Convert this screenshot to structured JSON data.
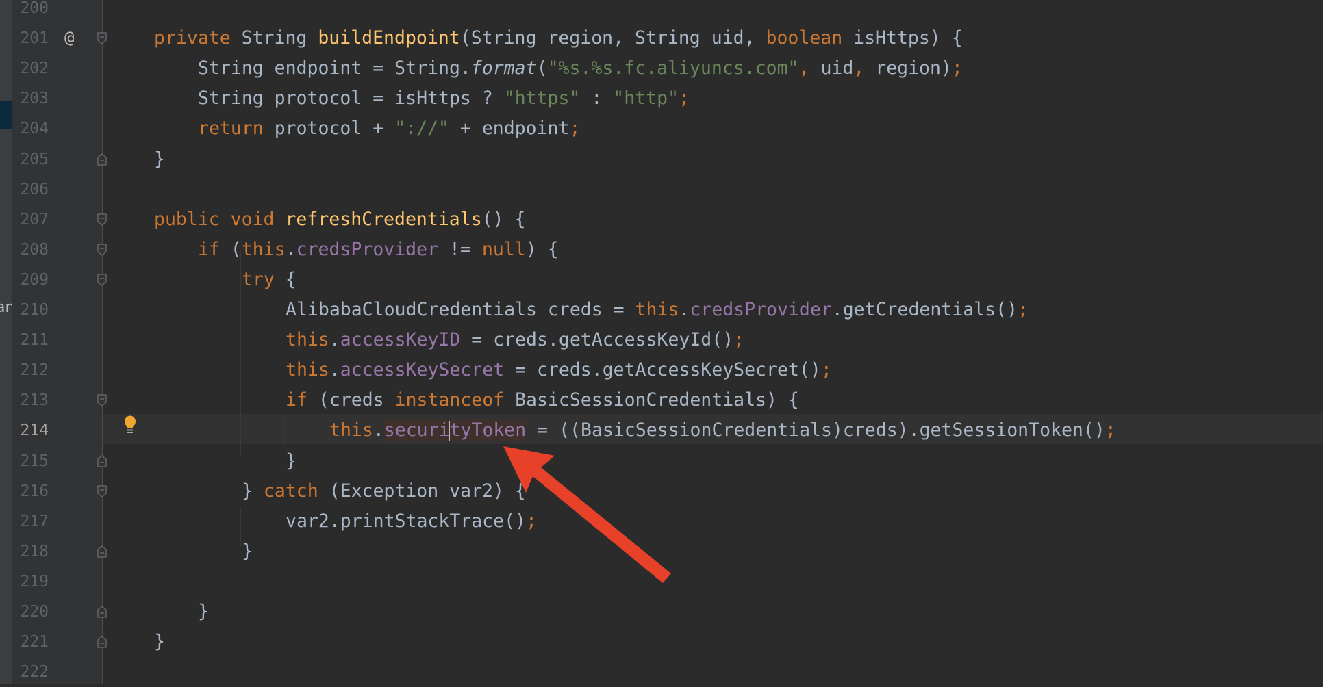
{
  "left_strip_fragment": "am",
  "current_line": 214,
  "colors": {
    "keyword": "#cc7832",
    "default": "#a9b7c6",
    "method_decl": "#ffc66d",
    "string": "#6a8759",
    "field": "#9876aa",
    "annotation_arrow": "#e8412a",
    "bulb": "#f0a732"
  },
  "gutter_icons": {
    "201": "override-at-icon",
    "214": "lightbulb-icon"
  },
  "code": {
    "lines": [
      {
        "n": "200",
        "indent": 0,
        "tokens": []
      },
      {
        "n": "201",
        "indent": 0,
        "fold": "open",
        "tokens": [
          [
            "kw",
            "private"
          ],
          [
            "pl",
            " String "
          ],
          [
            "fn",
            "buildEndpoint"
          ],
          [
            "pl",
            "(String region, String uid, "
          ],
          [
            "kw",
            "boolean"
          ],
          [
            "pl",
            " isHttps) {"
          ]
        ]
      },
      {
        "n": "202",
        "indent": 1,
        "tokens": [
          [
            "pl",
            "String endpoint = String."
          ],
          [
            "it",
            "format"
          ],
          [
            "pl",
            "("
          ],
          [
            "str",
            "\"%s.%s.fc.aliyuncs.com\""
          ],
          [
            "kw",
            ", "
          ],
          [
            "pl",
            "uid"
          ],
          [
            "kw",
            ", "
          ],
          [
            "pl",
            "region)"
          ],
          [
            "kw",
            ";"
          ]
        ]
      },
      {
        "n": "203",
        "indent": 1,
        "tokens": [
          [
            "pl",
            "String protocol = isHttps ? "
          ],
          [
            "str",
            "\"https\""
          ],
          [
            "pl",
            " : "
          ],
          [
            "str",
            "\"http\""
          ],
          [
            "kw",
            ";"
          ]
        ]
      },
      {
        "n": "204",
        "indent": 1,
        "tokens": [
          [
            "kw",
            "return"
          ],
          [
            "pl",
            " protocol + "
          ],
          [
            "str",
            "\"://\""
          ],
          [
            "pl",
            " + endpoint"
          ],
          [
            "kw",
            ";"
          ]
        ]
      },
      {
        "n": "205",
        "indent": 0,
        "fold": "close",
        "tokens": [
          [
            "pl",
            "}"
          ]
        ]
      },
      {
        "n": "206",
        "indent": 0,
        "tokens": []
      },
      {
        "n": "207",
        "indent": 0,
        "fold": "open",
        "tokens": [
          [
            "kw",
            "public void"
          ],
          [
            "pl",
            " "
          ],
          [
            "fn",
            "refreshCredentials"
          ],
          [
            "pl",
            "() {"
          ]
        ]
      },
      {
        "n": "208",
        "indent": 1,
        "fold": "open",
        "tokens": [
          [
            "kw",
            "if"
          ],
          [
            "pl",
            " ("
          ],
          [
            "kw",
            "this"
          ],
          [
            "pl",
            "."
          ],
          [
            "fld",
            "credsProvider"
          ],
          [
            "pl",
            " != "
          ],
          [
            "kw",
            "null"
          ],
          [
            "pl",
            ") {"
          ]
        ]
      },
      {
        "n": "209",
        "indent": 2,
        "fold": "open",
        "tokens": [
          [
            "kw",
            "try"
          ],
          [
            "pl",
            " {"
          ]
        ]
      },
      {
        "n": "210",
        "indent": 3,
        "tokens": [
          [
            "pl",
            "AlibabaCloudCredentials creds = "
          ],
          [
            "kw",
            "this"
          ],
          [
            "pl",
            "."
          ],
          [
            "fld",
            "credsProvider"
          ],
          [
            "pl",
            ".getCredentials()"
          ],
          [
            "kw",
            ";"
          ]
        ]
      },
      {
        "n": "211",
        "indent": 3,
        "tokens": [
          [
            "kw",
            "this"
          ],
          [
            "pl",
            "."
          ],
          [
            "fld",
            "accessKeyID"
          ],
          [
            "pl",
            " = creds.getAccessKeyId()"
          ],
          [
            "kw",
            ";"
          ]
        ]
      },
      {
        "n": "212",
        "indent": 3,
        "tokens": [
          [
            "kw",
            "this"
          ],
          [
            "pl",
            "."
          ],
          [
            "fld",
            "accessKeySecret"
          ],
          [
            "pl",
            " = creds.getAccessKeySecret()"
          ],
          [
            "kw",
            ";"
          ]
        ]
      },
      {
        "n": "213",
        "indent": 3,
        "fold": "open",
        "tokens": [
          [
            "kw",
            "if"
          ],
          [
            "pl",
            " (creds "
          ],
          [
            "kw",
            "instanceof"
          ],
          [
            "pl",
            " BasicSessionCredentials) {"
          ]
        ]
      },
      {
        "n": "214",
        "indent": 4,
        "tokens": [
          [
            "kw",
            "this"
          ],
          [
            "pl",
            "."
          ],
          [
            "fld hl",
            "securi"
          ],
          [
            "caret",
            ""
          ],
          [
            "fld hl",
            "tyToken"
          ],
          [
            "pl",
            " = ((BasicSessionCredentials)creds).getSessionToken()"
          ],
          [
            "kw",
            ";"
          ]
        ]
      },
      {
        "n": "215",
        "indent": 3,
        "fold": "close",
        "tokens": [
          [
            "pl",
            "}"
          ]
        ]
      },
      {
        "n": "216",
        "indent": 2,
        "fold": "open",
        "tokens": [
          [
            "pl",
            "} "
          ],
          [
            "kw",
            "catch"
          ],
          [
            "pl",
            " (Exception var2) {"
          ]
        ]
      },
      {
        "n": "217",
        "indent": 3,
        "tokens": [
          [
            "pl",
            "var2.printStackTrace()"
          ],
          [
            "kw",
            ";"
          ]
        ]
      },
      {
        "n": "218",
        "indent": 2,
        "fold": "close",
        "tokens": [
          [
            "pl",
            "}"
          ]
        ]
      },
      {
        "n": "219",
        "indent": 0,
        "tokens": []
      },
      {
        "n": "220",
        "indent": 1,
        "fold": "close",
        "tokens": [
          [
            "pl",
            "}"
          ]
        ]
      },
      {
        "n": "221",
        "indent": 0,
        "fold": "close",
        "tokens": [
          [
            "pl",
            "}"
          ]
        ]
      },
      {
        "n": "222",
        "indent": 0,
        "tokens": []
      }
    ]
  }
}
